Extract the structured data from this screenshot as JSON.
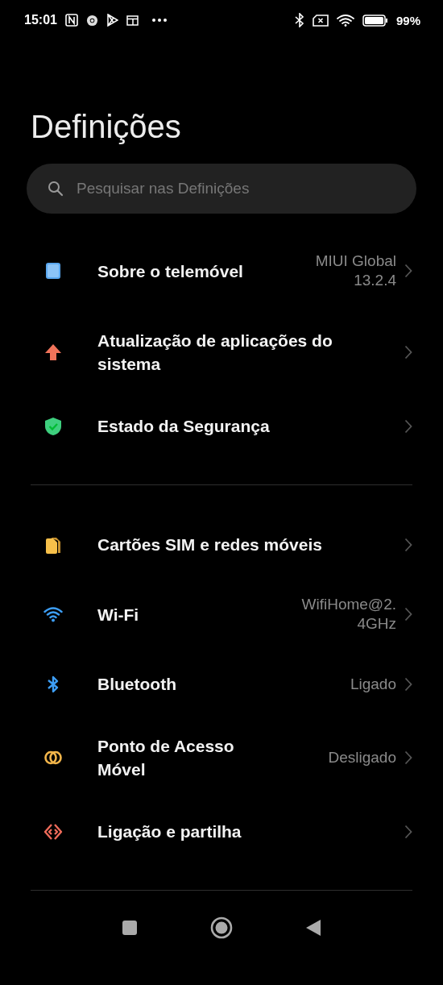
{
  "status_bar": {
    "time": "15:01",
    "battery": "99%"
  },
  "title": "Definições",
  "search": {
    "placeholder": "Pesquisar nas Definições"
  },
  "sections": [
    {
      "items": [
        {
          "kind": "phone",
          "label": "Sobre o telemóvel",
          "value": "MIUI Global 13.2.4"
        },
        {
          "kind": "update",
          "label": "Atualização de aplicações do sistema"
        },
        {
          "kind": "security",
          "label": "Estado da Segurança"
        }
      ]
    },
    {
      "items": [
        {
          "kind": "sim",
          "label": "Cartões SIM e redes móveis"
        },
        {
          "kind": "wifi",
          "label": "Wi-Fi",
          "value": "WifiHome@2.4GHz"
        },
        {
          "kind": "bluetooth",
          "label": "Bluetooth",
          "value": "Ligado"
        },
        {
          "kind": "hotspot",
          "label": "Ponto de Acesso Móvel",
          "value": "Desligado"
        },
        {
          "kind": "share",
          "label": "Ligação e partilha"
        }
      ]
    }
  ]
}
